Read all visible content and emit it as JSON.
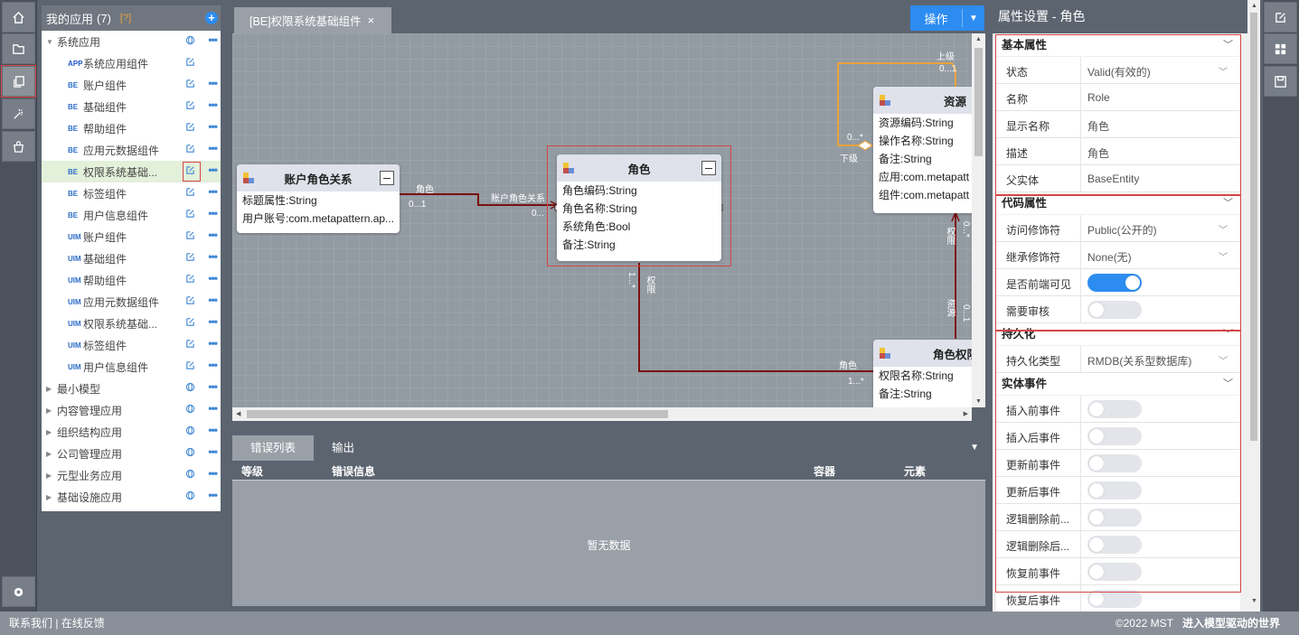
{
  "app_panel": {
    "title": "我的应用",
    "count": "(7)",
    "help": "[?]",
    "tree": [
      {
        "label": "系统应用",
        "badge": "",
        "kind": "group",
        "expanded": true
      },
      {
        "label": "系统应用组件",
        "badge": "APP",
        "kind": "item"
      },
      {
        "label": "账户组件",
        "badge": "BE",
        "kind": "item"
      },
      {
        "label": "基础组件",
        "badge": "BE",
        "kind": "item"
      },
      {
        "label": "帮助组件",
        "badge": "BE",
        "kind": "item"
      },
      {
        "label": "应用元数据组件",
        "badge": "BE",
        "kind": "item"
      },
      {
        "label": "权限系统基础...",
        "badge": "BE",
        "kind": "item",
        "selected": true
      },
      {
        "label": "标签组件",
        "badge": "BE",
        "kind": "item"
      },
      {
        "label": "用户信息组件",
        "badge": "BE",
        "kind": "item"
      },
      {
        "label": "账户组件",
        "badge": "UIM",
        "kind": "item"
      },
      {
        "label": "基础组件",
        "badge": "UIM",
        "kind": "item"
      },
      {
        "label": "帮助组件",
        "badge": "UIM",
        "kind": "item"
      },
      {
        "label": "应用元数据组件",
        "badge": "UIM",
        "kind": "item"
      },
      {
        "label": "权限系统基础...",
        "badge": "UIM",
        "kind": "item"
      },
      {
        "label": "标签组件",
        "badge": "UIM",
        "kind": "item"
      },
      {
        "label": "用户信息组件",
        "badge": "UIM",
        "kind": "item"
      },
      {
        "label": "最小模型",
        "badge": "",
        "kind": "group"
      },
      {
        "label": "内容管理应用",
        "badge": "",
        "kind": "group"
      },
      {
        "label": "组织结构应用",
        "badge": "",
        "kind": "group"
      },
      {
        "label": "公司管理应用",
        "badge": "",
        "kind": "group"
      },
      {
        "label": "元型业务应用",
        "badge": "",
        "kind": "group"
      },
      {
        "label": "基础设施应用",
        "badge": "",
        "kind": "group"
      }
    ]
  },
  "editor": {
    "tab_label": "[BE]权限系统基础组件",
    "tab_close": "×",
    "op_button": "操作",
    "entities": {
      "account_role": {
        "title": "账户角色关系",
        "attrs": [
          "标题属性:String",
          "用户账号:com.metapattern.ap..."
        ]
      },
      "role": {
        "title": "角色",
        "attrs": [
          "角色编码:String",
          "角色名称:String",
          "系统角色:Bool",
          "备注:String"
        ]
      },
      "resource": {
        "title": "资源",
        "attrs": [
          "资源编码:String",
          "操作名称:String",
          "备注:String",
          "应用:com.metapatt",
          "组件:com.metapatt"
        ]
      },
      "role_perm": {
        "title": "角色权限",
        "attrs": [
          "权限名称:String",
          "备注:String"
        ]
      }
    },
    "edge_labels": {
      "e1_left": "角色",
      "e1_left_mult": "0...1",
      "e1_right": "账户角色关系",
      "e1_right_mult": "0...",
      "e2_top": "1...*",
      "e2_top_lbl": "权限",
      "e2_right": "角色",
      "e2_right_mult": "1...*",
      "e3_top": "0...*",
      "e3_top_lbl": "权限",
      "e3_bottom": "0...1",
      "e3_bottom_lbl": "资源",
      "self_upper": "上级",
      "self_upper_mult": "0...1",
      "self_lower": "下级",
      "self_lower_mult": "0...*"
    }
  },
  "bottom_panel": {
    "tabs": [
      "错误列表",
      "输出"
    ],
    "columns": [
      "等级",
      "错误信息",
      "容器",
      "元素"
    ],
    "empty": "暂无数据"
  },
  "props": {
    "title": "属性设置 - 角色",
    "sections": [
      {
        "title": "基本属性",
        "rows": [
          {
            "label": "状态",
            "value": "Valid(有效的)",
            "type": "select"
          },
          {
            "label": "名称",
            "value": "Role",
            "type": "text"
          },
          {
            "label": "显示名称",
            "value": "角色",
            "type": "text"
          },
          {
            "label": "描述",
            "value": "角色",
            "type": "text"
          },
          {
            "label": "父实体",
            "value": "BaseEntity",
            "type": "text"
          }
        ]
      },
      {
        "title": "代码属性",
        "rows": [
          {
            "label": "访问修饰符",
            "value": "Public(公开的)",
            "type": "select"
          },
          {
            "label": "继承修饰符",
            "value": "None(无)",
            "type": "select"
          },
          {
            "label": "是否前端可见",
            "value": "on",
            "type": "toggle"
          },
          {
            "label": "需要审核",
            "value": "off",
            "type": "toggle"
          }
        ]
      },
      {
        "title": "持久化",
        "rows": [
          {
            "label": "持久化类型",
            "value": "RMDB(关系型数据库)",
            "type": "select"
          }
        ]
      },
      {
        "title": "实体事件",
        "rows": [
          {
            "label": "插入前事件",
            "value": "off",
            "type": "toggle"
          },
          {
            "label": "插入后事件",
            "value": "off",
            "type": "toggle"
          },
          {
            "label": "更新前事件",
            "value": "off",
            "type": "toggle"
          },
          {
            "label": "更新后事件",
            "value": "off",
            "type": "toggle"
          },
          {
            "label": "逻辑删除前...",
            "value": "off",
            "type": "toggle"
          },
          {
            "label": "逻辑删除后...",
            "value": "off",
            "type": "toggle"
          },
          {
            "label": "恢复前事件",
            "value": "off",
            "type": "toggle"
          },
          {
            "label": "恢复后事件",
            "value": "off",
            "type": "toggle"
          }
        ]
      }
    ]
  },
  "footer": {
    "left": "联系我们 | 在线反馈",
    "copyright": "©2022 MST",
    "slogan": "进入模型驱动的世界"
  }
}
